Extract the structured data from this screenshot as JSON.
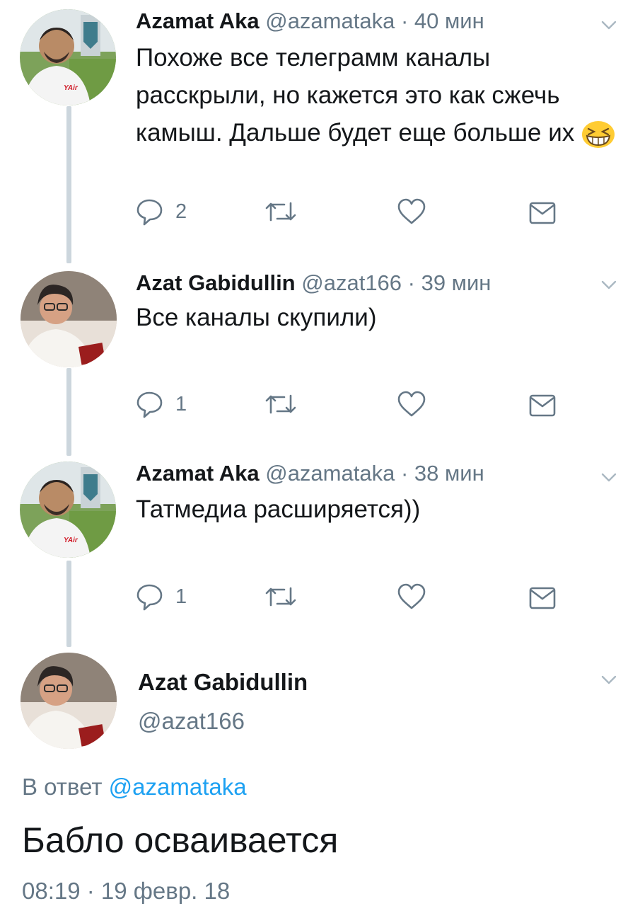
{
  "thread": [
    {
      "name": "Azamat Aka",
      "meta": "@azamataka · 40 мин",
      "text": "Похоже все телеграмм каналы расскрыли, но кажется это как сжечь камыш. Дальше будет еще больше их",
      "emoji": "grinning-squinting-face-emoji",
      "reply_count": "2"
    },
    {
      "name": "Azat Gabidullin",
      "meta": "@azat166 · 39 мин",
      "text": "Все каналы скупили)",
      "reply_count": "1"
    },
    {
      "name": "Azamat Aka",
      "meta": "@azamataka · 38 мин",
      "text": "Татмедиа расширяется))",
      "reply_count": "1"
    }
  ],
  "focused_tweet": {
    "name": "Azat Gabidullin",
    "handle": "@azat166",
    "reply_prefix": "В ответ",
    "reply_mention": "@azamataka",
    "text": "Бабло осваивается",
    "timestamp": "08:19 · 19 февр. 18"
  },
  "icons": {
    "reply": "reply-icon",
    "retweet": "retweet-icon",
    "like": "heart-icon",
    "dm": "envelope-icon",
    "menu": "chevron-down-icon"
  },
  "colors": {
    "text": "#14171a",
    "secondary": "#657786",
    "link": "#1da1f2",
    "thread_line": "#ccd6dd"
  }
}
